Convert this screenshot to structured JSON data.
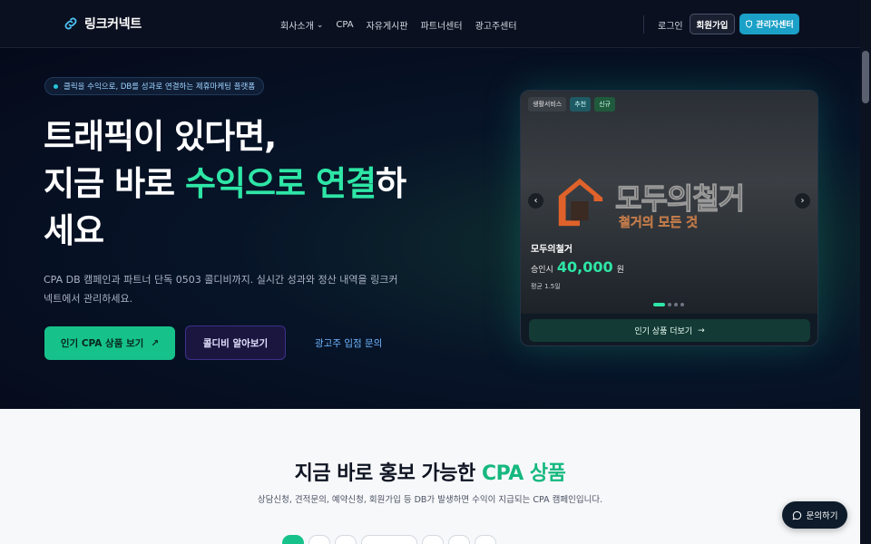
{
  "nav": {
    "logo_text": "링크커넥트",
    "menu": [
      "회사소개",
      "CPA",
      "자유게시판",
      "파트너센터",
      "광고주센터"
    ],
    "login": "로그인",
    "signup": "회원가입",
    "admin": "관리자센터"
  },
  "hero": {
    "pill": "클릭을 수익으로, DB를 성과로 연결하는 제휴마케팅 플랫폼",
    "title_line1": "트래픽이 있다면,",
    "title_line2_pre": "지금 바로 ",
    "title_line2_accent": "수익으로 연결",
    "title_line2_post": "하",
    "title_line3": "세요",
    "subtitle": "CPA DB 캠페인과 파트너 단독 0503 콜디비까지. 실시간 성과와 정산 내역을 링크커넥트에서 관리하세요.",
    "btn_primary": "인기 CPA 상품 보기",
    "btn_secondary": "콜디비 알아보기",
    "btn_link": "광고주 입점 문의"
  },
  "card": {
    "tags": [
      "생활서비스",
      "추천",
      "신규"
    ],
    "brand_name": "모두의철거",
    "brand_sub": "철거의 모든 것",
    "title": "모두의철거",
    "price_label": "승인시",
    "price": "40,000",
    "price_unit": "원",
    "avg": "평균 1.5일",
    "more": "인기 상품 더보기",
    "slide_position": 1,
    "slide_count": 4
  },
  "section": {
    "title_pre": "지금 바로 홍보 가능한 ",
    "title_accent": "CPA 상품",
    "subtitle": "상담신청, 견적문의, 예약신청, 회원가입 등 DB가 발생하면 수익이 지급되는 CPA 캠페인입니다."
  },
  "chat": {
    "label": "문의하기"
  },
  "colors": {
    "accent": "#2ee6a6",
    "primary_button": "#16c28a",
    "admin_button": "#1ba0c7"
  }
}
